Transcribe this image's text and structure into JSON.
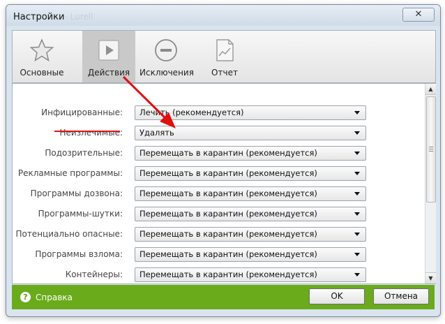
{
  "window": {
    "title": "Настройки",
    "close_glyph": "✕"
  },
  "toolbar": {
    "items": [
      {
        "label": "Основные",
        "icon": "star-icon"
      },
      {
        "label": "Действия",
        "icon": "play-icon",
        "active": true
      },
      {
        "label": "Исключения",
        "icon": "minus-circle-icon"
      },
      {
        "label": "Отчет",
        "icon": "report-icon"
      }
    ]
  },
  "settings": {
    "rows": [
      {
        "label": "Инфицированные:",
        "value": "Лечить (рекомендуется)"
      },
      {
        "label": "Неизлечимые:",
        "value": "Удалять"
      },
      {
        "label": "Подозрительные:",
        "value": "Перемещать в карантин (рекомендуется)"
      },
      {
        "label": "Рекламные программы:",
        "value": "Перемещать в карантин (рекомендуется)"
      },
      {
        "label": "Программы дозвона:",
        "value": "Перемещать в карантин (рекомендуется)"
      },
      {
        "label": "Программы-шутки:",
        "value": "Перемещать в карантин (рекомендуется)"
      },
      {
        "label": "Потенциально опасные:",
        "value": "Перемещать в карантин (рекомендуется)"
      },
      {
        "label": "Программы взлома:",
        "value": "Перемещать в карантин (рекомендуется)"
      },
      {
        "label": "Контейнеры:",
        "value": "Перемещать в карантин (рекомендуется)"
      }
    ]
  },
  "footer": {
    "help_label": "Справка",
    "ok_label": "OK",
    "cancel_label": "Отмена"
  },
  "colors": {
    "footer_bg": "#6aab1b",
    "annotation_red": "#e01010"
  }
}
